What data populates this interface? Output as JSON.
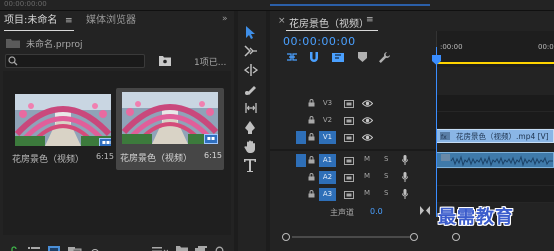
{
  "top_bar": {
    "timecode": "00:00:00:00"
  },
  "project_panel": {
    "tab_project": "项目:未命名",
    "tab_project_menu": "≡",
    "tab_media": "媒体浏览器",
    "expand": "»",
    "project_file": "未命名.prproj",
    "search_placeholder": "",
    "item_count": "1项已...",
    "clips": [
      {
        "name": "花房景色（视频）",
        "duration": "6:15",
        "selected": false
      },
      {
        "name": "花房景色（视频）",
        "duration": "6:15",
        "selected": true
      }
    ]
  },
  "tools": [
    "selection-tool",
    "track-select-tool",
    "ripple-edit-tool",
    "razor-tool",
    "slip-tool",
    "pen-tool",
    "hand-tool",
    "type-tool"
  ],
  "timeline": {
    "close": "×",
    "title": "花房景色（视频）",
    "menu": "≡",
    "timecode": "00:00:00:00",
    "ruler_start": ":00:00",
    "ruler_next": "00:00",
    "video_tracks": [
      {
        "label": "V3",
        "active": false
      },
      {
        "label": "V2",
        "active": false
      },
      {
        "label": "V1",
        "active": true
      }
    ],
    "audio_tracks": [
      {
        "label": "A1",
        "mute": "M",
        "solo": "S"
      },
      {
        "label": "A2",
        "mute": "M",
        "solo": "S"
      },
      {
        "label": "A3",
        "mute": "M",
        "solo": "S"
      }
    ],
    "video_clip_label": "花房景色（视频）.mp4 [V]",
    "master_label": "主声道",
    "master_value": "0.0"
  },
  "watermark": "最需教育",
  "colors": {
    "accent": "#2e6fb8",
    "timecode": "#4aa0ff",
    "video_clip": "#8ab6e6",
    "audio_clip": "#3f7aaa",
    "work_area": "#ffd400"
  }
}
